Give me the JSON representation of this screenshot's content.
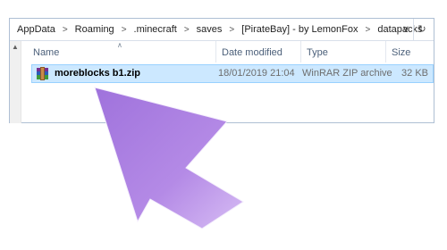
{
  "breadcrumb": [
    "AppData",
    "Roaming",
    ".minecraft",
    "saves",
    "[PirateBay] - by LemonFox",
    "datapacks"
  ],
  "address_controls": {
    "dropdown": "∨",
    "refresh": "↻"
  },
  "columns": {
    "name": "Name",
    "date": "Date modified",
    "type": "Type",
    "size": "Size"
  },
  "file": {
    "name": "moreblocks b1.zip",
    "date": "18/01/2019 21:04",
    "type": "WinRAR ZIP archive",
    "size": "32 KB",
    "icon": "winrar-zip-icon"
  },
  "colors": {
    "selection": "#cce8ff",
    "selection_border": "#99d1ff",
    "cursor_fill": "#b48ae6"
  }
}
